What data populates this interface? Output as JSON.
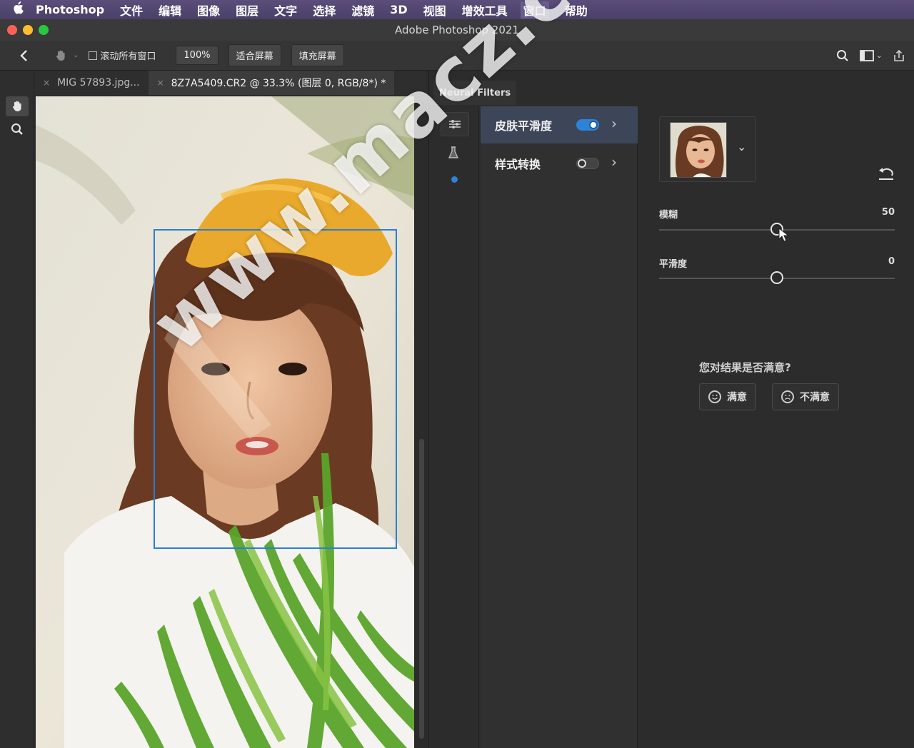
{
  "menubar": {
    "app": "Photoshop",
    "items": [
      "文件",
      "编辑",
      "图像",
      "图层",
      "文字",
      "选择",
      "滤镜",
      "3D",
      "视图",
      "增效工具",
      "窗口",
      "帮助"
    ]
  },
  "window": {
    "title": "Adobe Photoshop 2021"
  },
  "toolbar": {
    "scroll_all_label": "滚动所有窗口",
    "zoom_100": "100%",
    "fit_screen": "适合屏幕",
    "fill_screen": "填充屏幕"
  },
  "tabs": [
    {
      "label": "MIG 57893.jpg...",
      "active": false
    },
    {
      "label": "8Z7A5409.CR2 @ 33.3% (图层 0, RGB/8*) *",
      "active": true
    }
  ],
  "neural_filters": {
    "panel_title": "Neural Filters",
    "filters": [
      {
        "label": "皮肤平滑度",
        "enabled": true
      },
      {
        "label": "样式转换",
        "enabled": false
      }
    ],
    "settings": {
      "sliders": [
        {
          "label": "模糊",
          "value": "50",
          "fraction": 0.5
        },
        {
          "label": "平滑度",
          "value": "0",
          "fraction": 0.5
        }
      ],
      "question": "您对结果是否满意?",
      "satisfied": "满意",
      "unsatisfied": "不满意"
    }
  },
  "watermark": "www.macz.com",
  "colors": {
    "accent": "#2d83d6",
    "face_box": "#2a7fd1",
    "selected_row": "#3d4659"
  }
}
